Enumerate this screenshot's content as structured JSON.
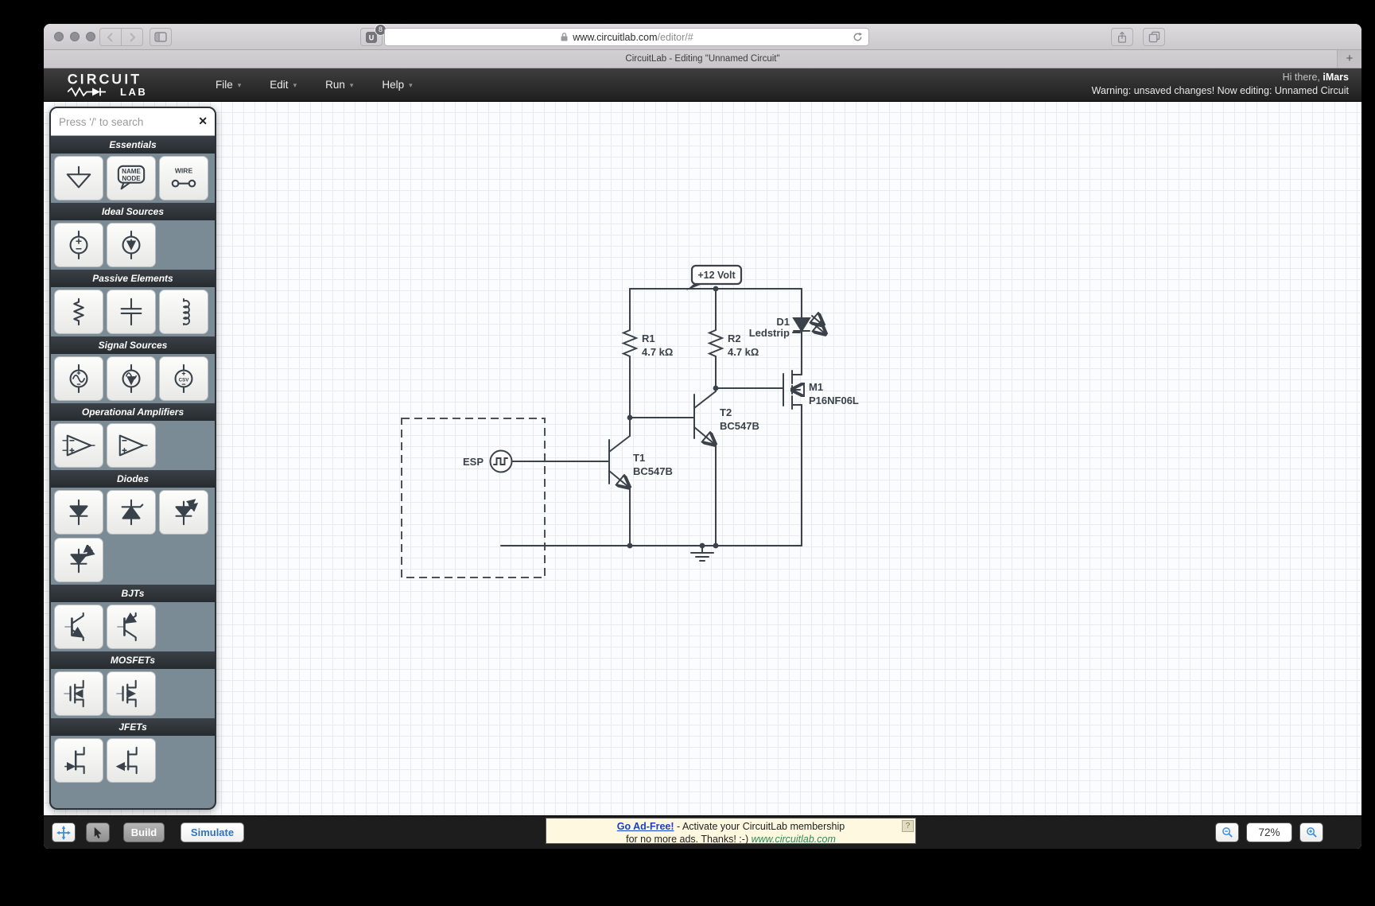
{
  "browser": {
    "url_host": "www.circuitlab.com",
    "url_path": "/editor/#",
    "tab_title": "CircuitLab - Editing \"Unnamed Circuit\"",
    "extension_letter": "U",
    "extension_badge": "8",
    "new_tab_label": "+"
  },
  "app_header": {
    "logo_line1": "CIRCUIT",
    "logo_line2": "LAB",
    "menus": [
      {
        "label": "File"
      },
      {
        "label": "Edit"
      },
      {
        "label": "Run"
      },
      {
        "label": "Help"
      }
    ],
    "greeting_prefix": "Hi there, ",
    "username": "iMars",
    "warning": "Warning: unsaved changes! Now editing: Unnamed Circuit"
  },
  "sidebar": {
    "search_placeholder": "Press '/' to search",
    "clear_label": "✕",
    "sections": [
      {
        "label": "Essentials",
        "items": [
          {
            "id": "ground",
            "icon": "ground-icon"
          },
          {
            "id": "name-node",
            "icon": "name-node-icon",
            "label": "NAME NODE"
          },
          {
            "id": "wire",
            "icon": "wire-icon",
            "label": "WIRE"
          }
        ]
      },
      {
        "label": "Ideal Sources",
        "items": [
          {
            "id": "voltage-source",
            "icon": "voltage-source-icon"
          },
          {
            "id": "current-source",
            "icon": "current-source-icon"
          }
        ]
      },
      {
        "label": "Passive Elements",
        "items": [
          {
            "id": "resistor",
            "icon": "resistor-icon"
          },
          {
            "id": "capacitor",
            "icon": "capacitor-icon"
          },
          {
            "id": "inductor",
            "icon": "inductor-icon"
          }
        ]
      },
      {
        "label": "Signal Sources",
        "items": [
          {
            "id": "sine-voltage-source",
            "icon": "sine-voltage-source-icon"
          },
          {
            "id": "sine-current-source",
            "icon": "sine-current-source-icon"
          },
          {
            "id": "csv-source",
            "icon": "csv-source-icon",
            "label": "CSV"
          }
        ]
      },
      {
        "label": "Operational Amplifiers",
        "items": [
          {
            "id": "opamp",
            "icon": "opamp-icon"
          },
          {
            "id": "opamp-basic",
            "icon": "opamp-basic-icon"
          }
        ]
      },
      {
        "label": "Diodes",
        "items": [
          {
            "id": "diode",
            "icon": "diode-icon"
          },
          {
            "id": "zener-diode",
            "icon": "zener-diode-icon"
          },
          {
            "id": "led",
            "icon": "led-icon"
          },
          {
            "id": "photodiode",
            "icon": "photodiode-icon"
          }
        ]
      },
      {
        "label": "BJTs",
        "items": [
          {
            "id": "npn-transistor",
            "icon": "npn-transistor-icon"
          },
          {
            "id": "pnp-transistor",
            "icon": "pnp-transistor-icon"
          }
        ]
      },
      {
        "label": "MOSFETs",
        "items": [
          {
            "id": "nmos-transistor",
            "icon": "nmos-transistor-icon"
          },
          {
            "id": "pmos-transistor",
            "icon": "pmos-transistor-icon"
          }
        ]
      },
      {
        "label": "JFETs",
        "items": [
          {
            "id": "n-jfet",
            "icon": "n-jfet-icon"
          },
          {
            "id": "p-jfet",
            "icon": "p-jfet-icon"
          }
        ]
      }
    ]
  },
  "circuit": {
    "supply_label": "+12 Volt",
    "components": {
      "r1": {
        "name": "R1",
        "value": "4.7 kΩ"
      },
      "r2": {
        "name": "R2",
        "value": "4.7 kΩ"
      },
      "d1": {
        "name": "D1",
        "value": "Ledstrip"
      },
      "m1": {
        "name": "M1",
        "value": "P16NF06L"
      },
      "t1": {
        "name": "T1",
        "value": "BC547B"
      },
      "t2": {
        "name": "T2",
        "value": "BC547B"
      },
      "esp": {
        "name": "ESP"
      }
    }
  },
  "footer": {
    "build_label": "Build",
    "simulate_label": "Simulate",
    "zoom_level": "72%",
    "ad": {
      "link": "Go Ad-Free!",
      "text1": " - Activate your CircuitLab membership",
      "text2": "for no more ads. Thanks! :-) ",
      "url": "www.circuitlab.com",
      "help": "?"
    }
  },
  "colors": {
    "accent_blue": "#2f74c0",
    "schematic": "#3b4249",
    "sidebar_bg": "#7b8b96",
    "ad_link": "#1a3fc4",
    "ad_url": "#2e8b57"
  }
}
